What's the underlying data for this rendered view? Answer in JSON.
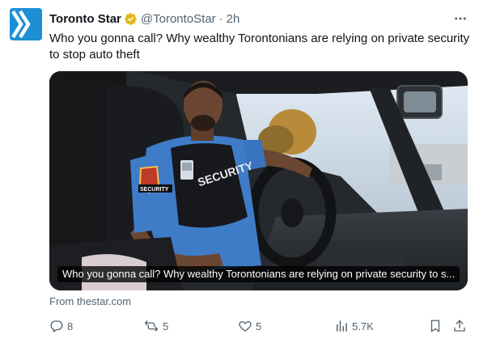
{
  "tweet": {
    "author_name": "Toronto Star",
    "author_handle": "@TorontoStar",
    "separator": "·",
    "time": "2h",
    "text": "Who you gonna call? Why wealthy Torontonians are relying on private security to stop auto theft",
    "media": {
      "caption": "Who you gonna call? Why wealthy Torontonians are relying on private security to s...",
      "vest_label": "SECURITY",
      "patch_label": "SECURITY"
    },
    "card_source": "From thestar.com",
    "metrics": {
      "replies": "8",
      "reposts": "5",
      "likes": "5",
      "views": "5.7K"
    }
  },
  "colors": {
    "brand": "#1d8fd6",
    "verified": "#e2b719",
    "text": "#0f1419",
    "muted": "#536471"
  },
  "icons": [
    "toronto-star-logo",
    "verified-badge-icon",
    "more-options-icon",
    "reply-icon",
    "repost-icon",
    "like-icon",
    "views-icon",
    "bookmark-icon",
    "share-icon"
  ]
}
